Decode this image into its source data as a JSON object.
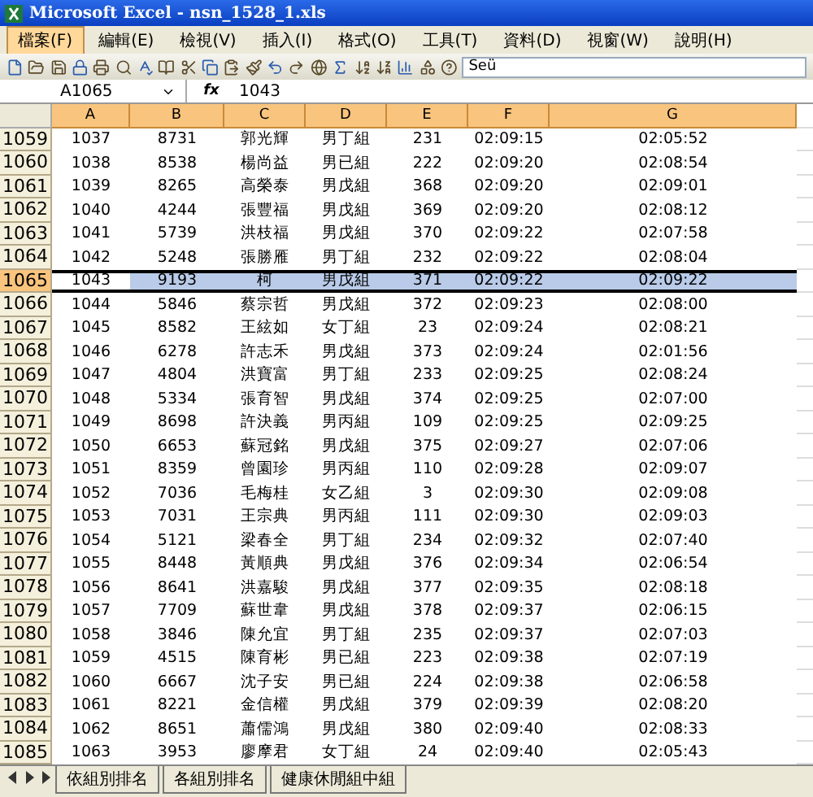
{
  "window": {
    "title": "Microsoft Excel - nsn_1528_1.xls"
  },
  "menu": [
    {
      "label": "檔案(F)",
      "selected": true
    },
    {
      "label": "編輯(E)",
      "selected": false
    },
    {
      "label": "檢視(V)",
      "selected": false
    },
    {
      "label": "插入(I)",
      "selected": false
    },
    {
      "label": "格式(O)",
      "selected": false
    },
    {
      "label": "工具(T)",
      "selected": false
    },
    {
      "label": "資料(D)",
      "selected": false
    },
    {
      "label": "視窗(W)",
      "selected": false
    },
    {
      "label": "說明(H)",
      "selected": false
    }
  ],
  "toolbar": {
    "font": "Seü"
  },
  "formula_bar": {
    "name_box": "A1065",
    "fx": "fx",
    "value": "1043"
  },
  "table": {
    "columns": [
      {
        "label": "A",
        "selected": true
      },
      {
        "label": "B",
        "selected": true
      },
      {
        "label": "C",
        "selected": true
      },
      {
        "label": "D",
        "selected": true
      },
      {
        "label": "E",
        "selected": true
      },
      {
        "label": "F",
        "selected": true
      },
      {
        "label": "G",
        "selected": true
      }
    ],
    "rows": [
      {
        "row": "1059",
        "selected": false,
        "cells": [
          "1037",
          "8731",
          "郭光輝",
          "男丁組",
          "231",
          "02:09:15",
          "02:05:52"
        ]
      },
      {
        "row": "1060",
        "selected": false,
        "cells": [
          "1038",
          "8538",
          "楊尚益",
          "男已組",
          "222",
          "02:09:20",
          "02:08:54"
        ]
      },
      {
        "row": "1061",
        "selected": false,
        "cells": [
          "1039",
          "8265",
          "高榮泰",
          "男戊組",
          "368",
          "02:09:20",
          "02:09:01"
        ]
      },
      {
        "row": "1062",
        "selected": false,
        "cells": [
          "1040",
          "4244",
          "張豐福",
          "男戊組",
          "369",
          "02:09:20",
          "02:08:12"
        ]
      },
      {
        "row": "1063",
        "selected": false,
        "cells": [
          "1041",
          "5739",
          "洪枝福",
          "男戊組",
          "370",
          "02:09:22",
          "02:07:58"
        ]
      },
      {
        "row": "1064",
        "selected": false,
        "cells": [
          "1042",
          "5248",
          "張勝雁",
          "男丁組",
          "232",
          "02:09:22",
          "02:08:04"
        ]
      },
      {
        "row": "1065",
        "selected": true,
        "cells": [
          "1043",
          "9193",
          "柯",
          "男戊組",
          "371",
          "02:09:22",
          "02:09:22"
        ]
      },
      {
        "row": "1066",
        "selected": false,
        "cells": [
          "1044",
          "5846",
          "蔡宗哲",
          "男戊組",
          "372",
          "02:09:23",
          "02:08:00"
        ]
      },
      {
        "row": "1067",
        "selected": false,
        "cells": [
          "1045",
          "8582",
          "王絃如",
          "女丁組",
          "23",
          "02:09:24",
          "02:08:21"
        ]
      },
      {
        "row": "1068",
        "selected": false,
        "cells": [
          "1046",
          "6278",
          "許志禾",
          "男戊組",
          "373",
          "02:09:24",
          "02:01:56"
        ]
      },
      {
        "row": "1069",
        "selected": false,
        "cells": [
          "1047",
          "4804",
          "洪寶富",
          "男丁組",
          "233",
          "02:09:25",
          "02:08:24"
        ]
      },
      {
        "row": "1070",
        "selected": false,
        "cells": [
          "1048",
          "5334",
          "張育智",
          "男戊組",
          "374",
          "02:09:25",
          "02:07:00"
        ]
      },
      {
        "row": "1071",
        "selected": false,
        "cells": [
          "1049",
          "8698",
          "許決義",
          "男丙組",
          "109",
          "02:09:25",
          "02:09:25"
        ]
      },
      {
        "row": "1072",
        "selected": false,
        "cells": [
          "1050",
          "6653",
          "蘇冠銘",
          "男戊組",
          "375",
          "02:09:27",
          "02:07:06"
        ]
      },
      {
        "row": "1073",
        "selected": false,
        "cells": [
          "1051",
          "8359",
          "曾園珍",
          "男丙組",
          "110",
          "02:09:28",
          "02:09:07"
        ]
      },
      {
        "row": "1074",
        "selected": false,
        "cells": [
          "1052",
          "7036",
          "毛梅桂",
          "女乙組",
          "3",
          "02:09:30",
          "02:09:08"
        ]
      },
      {
        "row": "1075",
        "selected": false,
        "cells": [
          "1053",
          "7031",
          "王宗典",
          "男丙組",
          "111",
          "02:09:30",
          "02:09:03"
        ]
      },
      {
        "row": "1076",
        "selected": false,
        "cells": [
          "1054",
          "5121",
          "梁春全",
          "男丁組",
          "234",
          "02:09:32",
          "02:07:40"
        ]
      },
      {
        "row": "1077",
        "selected": false,
        "cells": [
          "1055",
          "8448",
          "黃順典",
          "男戊組",
          "376",
          "02:09:34",
          "02:06:54"
        ]
      },
      {
        "row": "1078",
        "selected": false,
        "cells": [
          "1056",
          "8641",
          "洪嘉駿",
          "男戊組",
          "377",
          "02:09:35",
          "02:08:18"
        ]
      },
      {
        "row": "1079",
        "selected": false,
        "cells": [
          "1057",
          "7709",
          "蘇世韋",
          "男戊組",
          "378",
          "02:09:37",
          "02:06:15"
        ]
      },
      {
        "row": "1080",
        "selected": false,
        "cells": [
          "1058",
          "3846",
          "陳允宜",
          "男丁組",
          "235",
          "02:09:37",
          "02:07:03"
        ]
      },
      {
        "row": "1081",
        "selected": false,
        "cells": [
          "1059",
          "4515",
          "陳育彬",
          "男已組",
          "223",
          "02:09:38",
          "02:07:19"
        ]
      },
      {
        "row": "1082",
        "selected": false,
        "cells": [
          "1060",
          "6667",
          "沈子安",
          "男已組",
          "224",
          "02:09:38",
          "02:06:58"
        ]
      },
      {
        "row": "1083",
        "selected": false,
        "cells": [
          "1061",
          "8221",
          "金信權",
          "男戊組",
          "379",
          "02:09:39",
          "02:08:20"
        ]
      },
      {
        "row": "1084",
        "selected": false,
        "cells": [
          "1062",
          "8651",
          "蕭儒鴻",
          "男戊組",
          "380",
          "02:09:40",
          "02:08:33"
        ]
      },
      {
        "row": "1085",
        "selected": false,
        "cells": [
          "1063",
          "3953",
          "廖摩君",
          "女丁組",
          "24",
          "02:09:40",
          "02:05:43"
        ]
      }
    ]
  },
  "sheet_tabs": [
    {
      "label": "依組別排名",
      "selected": false
    },
    {
      "label": "各組別排名",
      "selected": false
    },
    {
      "label": "健康休閒組中組",
      "selected": false
    }
  ]
}
